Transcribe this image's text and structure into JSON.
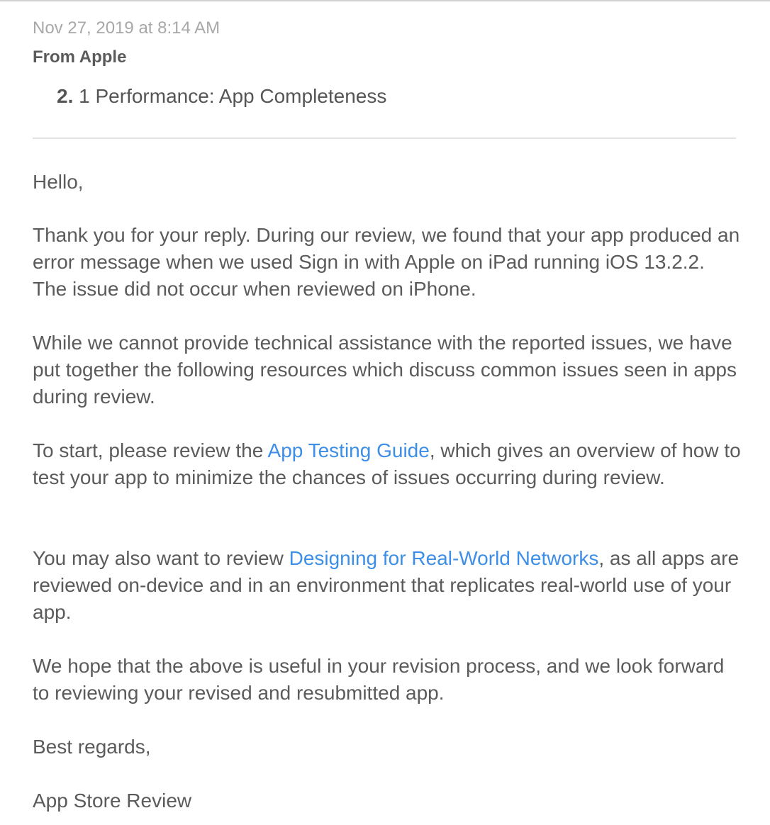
{
  "header": {
    "date": "Nov 27, 2019 at 8:14 AM",
    "from": "From Apple",
    "guideline_number": "2.",
    "guideline_text": " 1 Performance: App Completeness"
  },
  "message": {
    "greeting": "Hello,",
    "p1": "Thank you for your reply. During our review, we found that your app produced an error message when we used Sign in with Apple on iPad running iOS 13.2.2. The issue did not occur when reviewed on iPhone.",
    "p2": "While we cannot provide technical assistance with the reported issues, we have put together the following resources which discuss common issues seen in apps during review.",
    "p3_before": "To start, please review the ",
    "p3_link": "App Testing Guide",
    "p3_after": ", which gives an overview of how to test your app to minimize the chances of issues occurring during review.",
    "p4_before": "You may also want to review ",
    "p4_link": "Designing for Real-World Networks",
    "p4_after": ", as all apps are reviewed on-device and in an environment that replicates real-world use of your app.",
    "p5": "We hope that the above is useful in your revision process, and we look forward to reviewing your revised and resubmitted app.",
    "closing": "Best regards,",
    "signature": "App Store Review"
  },
  "colors": {
    "link": "#3d8ee6",
    "text": "#5b5b5b",
    "date": "#a8a8a8"
  }
}
